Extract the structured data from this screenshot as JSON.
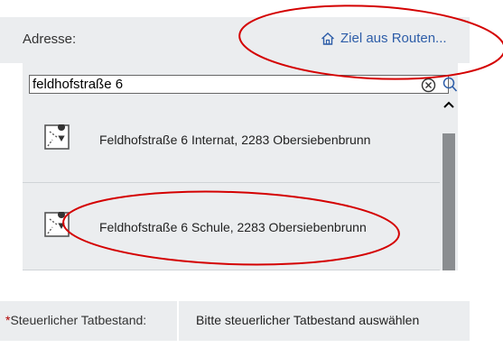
{
  "address": {
    "label": "Adresse:",
    "route_link": "Ziel aus Routen...",
    "route_icon": "home-icon"
  },
  "search": {
    "value": "feldhofstraße 6"
  },
  "results": [
    {
      "text": "Feldhofstraße 6 Internat, 2283 Obersiebenbrunn",
      "icon": "map-pin-icon"
    },
    {
      "text": "Feldhofstraße 6 Schule, 2283 Obersiebenbrunn",
      "icon": "map-pin-icon"
    }
  ],
  "tax": {
    "required_mark": "*",
    "label": "Steuerlicher Tatbestand:",
    "placeholder": "Bitte steuerlicher Tatbestand auswählen"
  },
  "colors": {
    "panel": "#ebedef",
    "link": "#2d5da8",
    "annotation": "#d40000",
    "required": "#b00000"
  }
}
